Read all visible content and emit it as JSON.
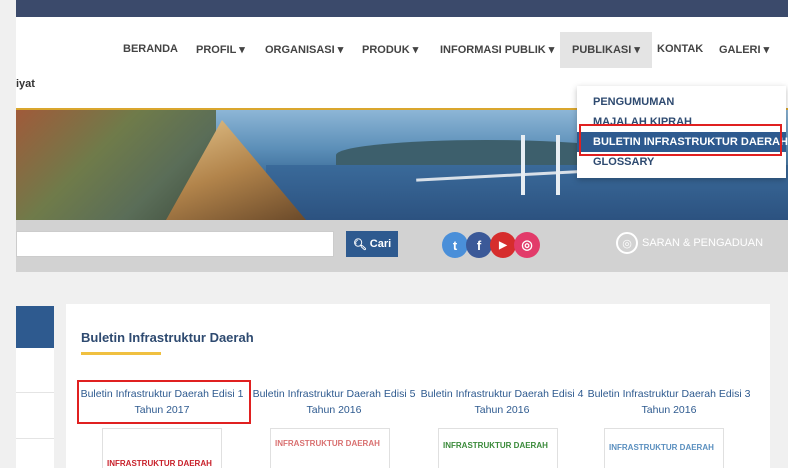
{
  "header": {
    "brand_fragment": "iyat"
  },
  "nav": {
    "items": [
      {
        "label": "BERANDA"
      },
      {
        "label": "PROFIL ▾"
      },
      {
        "label": "ORGANISASI ▾"
      },
      {
        "label": "PRODUK ▾"
      },
      {
        "label": "INFORMASI PUBLIK ▾"
      },
      {
        "label": "PUBLIKASI ▾"
      },
      {
        "label": "KONTAK"
      },
      {
        "label": "GALERI ▾"
      }
    ],
    "dropdown": {
      "items": [
        {
          "label": "PENGUMUMAN"
        },
        {
          "label": "MAJALAH KIPRAH"
        },
        {
          "label": "BULETIN INFRASTRUKTUR DAERAH"
        },
        {
          "label": "GLOSSARY"
        }
      ]
    }
  },
  "search": {
    "placeholder": "",
    "button_label": "Cari"
  },
  "social": {
    "twitter": "t",
    "facebook": "f",
    "youtube": "▶",
    "instagram": "◎"
  },
  "saran": {
    "label": "SARAN & PENGADUAN"
  },
  "card": {
    "title": "Buletin Infrastruktur Daerah",
    "items": [
      {
        "line1": "Buletin Infrastruktur Daerah Edisi 1",
        "line2": "Tahun 2017",
        "thumb": "INFRASTRUKTUR DAERAH"
      },
      {
        "line1": "Buletin Infrastruktur Daerah Edisi 5",
        "line2": "Tahun 2016",
        "thumb": "INFRASTRUKTUR DAERAH"
      },
      {
        "line1": "Buletin Infrastruktur Daerah Edisi 4",
        "line2": "Tahun 2016",
        "thumb": "INFRASTRUKTUR DAERAH"
      },
      {
        "line1": "Buletin Infrastruktur Daerah Edisi 3",
        "line2": "Tahun 2016",
        "thumb": "INFRASTRUKTUR DAERAH"
      }
    ]
  },
  "colors": {
    "primary": "#2e5a8f",
    "accent": "#d9a62e",
    "highlight": "#e02020"
  }
}
